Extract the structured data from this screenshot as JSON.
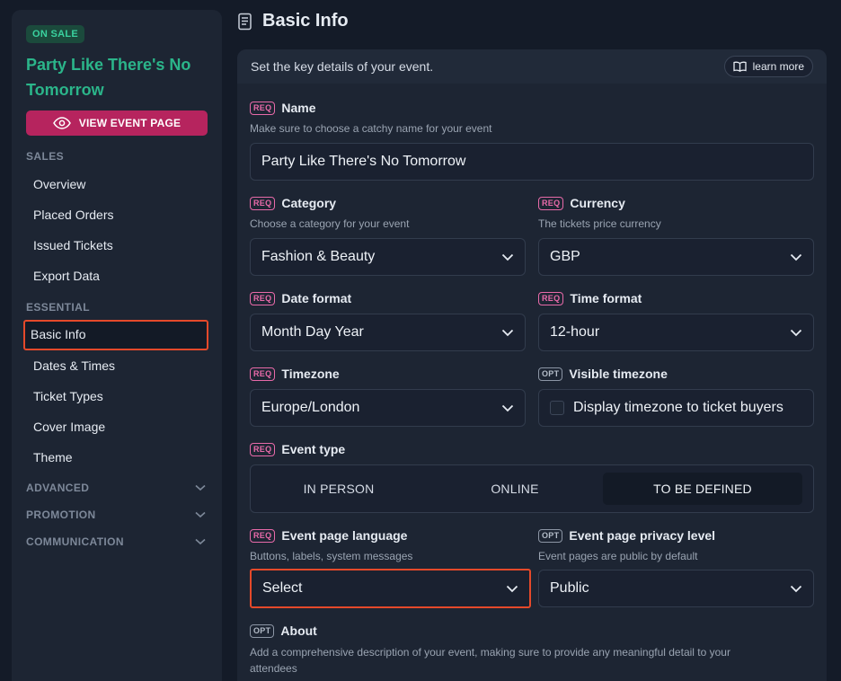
{
  "sidebar": {
    "status_badge": "ON SALE",
    "event_title": "Party Like There's No Tomorrow",
    "view_button": "VIEW EVENT PAGE",
    "sections": {
      "sales": "SALES",
      "essential": "ESSENTIAL",
      "advanced": "ADVANCED",
      "promotion": "PROMOTION",
      "communication": "COMMUNICATION"
    },
    "sales_items": [
      "Overview",
      "Placed Orders",
      "Issued Tickets",
      "Export Data"
    ],
    "essential_items": [
      "Basic Info",
      "Dates & Times",
      "Ticket Types",
      "Cover Image",
      "Theme"
    ],
    "active_item": "Basic Info"
  },
  "page": {
    "title": "Basic Info",
    "intro": "Set the key details of your event.",
    "learn_more": "learn more"
  },
  "tags": {
    "req": "REQ",
    "opt": "OPT"
  },
  "form": {
    "name": {
      "label": "Name",
      "hint": "Make sure to choose a catchy name for your event",
      "value": "Party Like There's No Tomorrow"
    },
    "category": {
      "label": "Category",
      "hint": "Choose a category for your event",
      "value": "Fashion & Beauty"
    },
    "currency": {
      "label": "Currency",
      "hint": "The tickets price currency",
      "value": "GBP"
    },
    "date_format": {
      "label": "Date format",
      "value": "Month Day Year"
    },
    "time_format": {
      "label": "Time format",
      "value": "12-hour"
    },
    "timezone": {
      "label": "Timezone",
      "value": "Europe/London"
    },
    "visible_timezone": {
      "label": "Visible timezone",
      "checkbox_label": "Display timezone to ticket buyers",
      "checked": false
    },
    "event_type": {
      "label": "Event type",
      "options": [
        "IN PERSON",
        "ONLINE",
        "TO BE DEFINED"
      ],
      "selected": "TO BE DEFINED"
    },
    "language": {
      "label": "Event page language",
      "hint": "Buttons, labels, system messages",
      "value": "Select"
    },
    "privacy": {
      "label": "Event page privacy level",
      "hint": "Event pages are public by default",
      "value": "Public"
    },
    "about": {
      "label": "About",
      "hint": "Add a comprehensive description of your event, making sure to provide any meaningful detail to your attendees"
    }
  },
  "colors": {
    "accent_pink": "#b6245e",
    "highlight": "#e5492a",
    "sale_green": "#3ad29f",
    "title_green": "#2bb58a"
  }
}
